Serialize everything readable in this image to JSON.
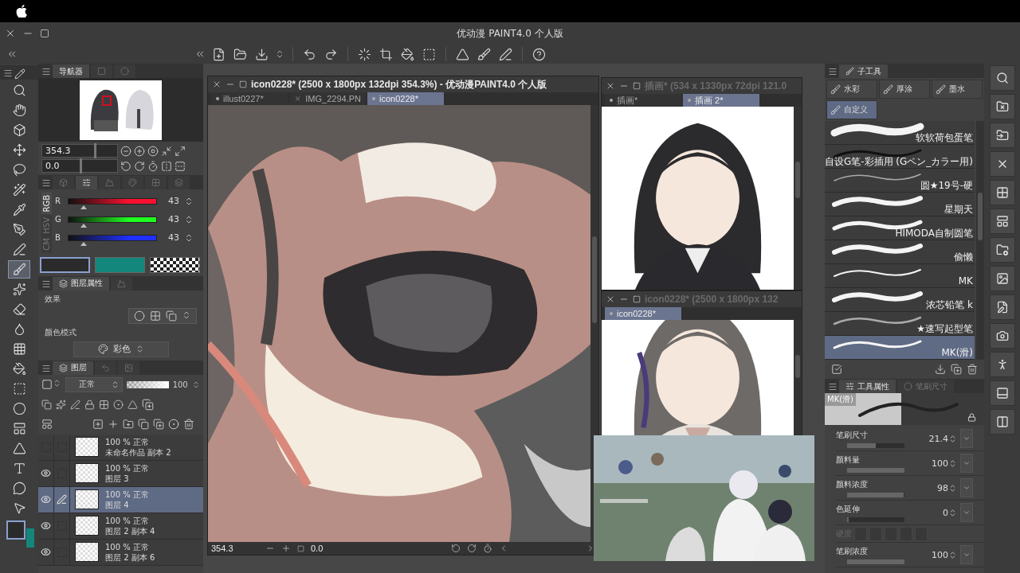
{
  "window": {
    "title": "优动漫 PAINT4.0 个人版"
  },
  "navigator": {
    "tab": "导航器",
    "zoom": {
      "value": "354.3",
      "level": 0.7
    },
    "angle": {
      "value": "0.0",
      "level": 0.5
    }
  },
  "color_panel_tabs": [
    {
      "selected": false
    },
    {
      "selected": true
    },
    {
      "selected": false
    },
    {
      "selected": false
    },
    {
      "selected": false
    },
    {
      "selected": false
    }
  ],
  "color_sliders": {
    "modes": [
      {
        "label": "RGB",
        "selected": true
      },
      {
        "label": "HSV",
        "selected": false
      },
      {
        "label": "CM",
        "selected": false
      }
    ],
    "channels": [
      {
        "name": "R",
        "value": "43",
        "level": 0.17,
        "color": "#ff1030"
      },
      {
        "name": "G",
        "value": "43",
        "level": 0.17,
        "color": "#20ff20"
      },
      {
        "name": "B",
        "value": "43",
        "level": 0.17,
        "color": "#2030ff"
      }
    ]
  },
  "color_swatches": [
    {
      "kind": "main",
      "color": "#2b2b2b",
      "selected": true
    },
    {
      "kind": "sub",
      "color": "#14877c",
      "selected": false
    },
    {
      "kind": "transparent",
      "selected": false
    }
  ],
  "layer_property": {
    "tab": "图层属性",
    "effect_label": "效果",
    "color_mode_label": "颜色模式",
    "color_mode": "彩色"
  },
  "layers": {
    "tab": "图层",
    "blend": "正常",
    "opacity": {
      "value": "100",
      "level": 1
    },
    "items": [
      {
        "info": "100 % 正常",
        "name": "未命名作品 副本 2",
        "visible": false,
        "selected": false
      },
      {
        "info": "100 % 正常",
        "name": "图层 3",
        "visible": true,
        "selected": false
      },
      {
        "info": "100 % 正常",
        "name": "图层 4",
        "visible": true,
        "selected": true
      },
      {
        "info": "100 % 正常",
        "name": "图层 2 副本 4",
        "visible": true,
        "selected": false
      },
      {
        "info": "100 % 正常",
        "name": "图层 2 副本 6",
        "visible": true,
        "selected": false
      }
    ]
  },
  "documents": [
    {
      "title": "icon0228* (2500 x 1800px 132dpi 354.3%)  - 优动漫PAINT4.0 个人版",
      "active": true,
      "tabs": [
        {
          "label": "illust0227*",
          "selected": false,
          "hovered": false
        },
        {
          "label": "IMG_2294.PN",
          "selected": false,
          "hovered": true
        },
        {
          "label": "icon0228*",
          "selected": true,
          "hovered": false
        }
      ],
      "zoom": "354.3",
      "angle": "0.0"
    },
    {
      "title": "插画* (534 x 1330px 72dpi 121.0",
      "active": false,
      "tabs": [
        {
          "label": "插画*",
          "selected": false,
          "hovered": false
        },
        {
          "label": "插画 2*",
          "selected": true,
          "hovered": false
        }
      ]
    },
    {
      "title": "icon0228* (2500 x 1800px 132",
      "active": false,
      "tabs": [
        {
          "label": "icon0228*",
          "selected": true,
          "hovered": false
        }
      ]
    }
  ],
  "sub_tool": {
    "tab": "子工具",
    "groups": [
      {
        "label": "水彩",
        "selected": false
      },
      {
        "label": "厚涂",
        "selected": false
      },
      {
        "label": "墨水",
        "selected": false
      },
      {
        "label": "自定义",
        "selected": true
      }
    ],
    "brushes": [
      {
        "name": "软软荷包蛋笔",
        "selected": false
      },
      {
        "name": "自设G笔-彩插用 (Gペン_カラー用)",
        "selected": false
      },
      {
        "name": "圆★19号-硬",
        "selected": false
      },
      {
        "name": "星期天",
        "selected": false
      },
      {
        "name": "HIMODA自制圆笔",
        "selected": false
      },
      {
        "name": "偷懒",
        "selected": false
      },
      {
        "name": "MK",
        "selected": false
      },
      {
        "name": "浓芯铅笔 k",
        "selected": false
      },
      {
        "name": "★速写起型笔",
        "selected": false
      },
      {
        "name": "MK(滑)",
        "selected": true
      }
    ]
  },
  "tool_property": {
    "tabs": [
      {
        "label": "工具属性",
        "selected": true
      },
      {
        "label": "笔刷尺寸",
        "selected": false
      }
    ],
    "preview_label": "MK(滑)",
    "settings": [
      {
        "kind": "slider",
        "label": "笔刷尺寸",
        "value": "21.4",
        "level": 0.5
      },
      {
        "kind": "slider",
        "label": "颜料量",
        "value": "100",
        "level": 1
      },
      {
        "kind": "slider",
        "label": "颜料浓度",
        "value": "98",
        "level": 0.98
      },
      {
        "kind": "slider",
        "label": "色延伸",
        "value": "0",
        "level": 0
      },
      {
        "kind": "steps",
        "label": "硬度",
        "disabled": true
      },
      {
        "kind": "slider",
        "label": "笔刷浓度",
        "value": "100",
        "level": 1
      }
    ]
  }
}
